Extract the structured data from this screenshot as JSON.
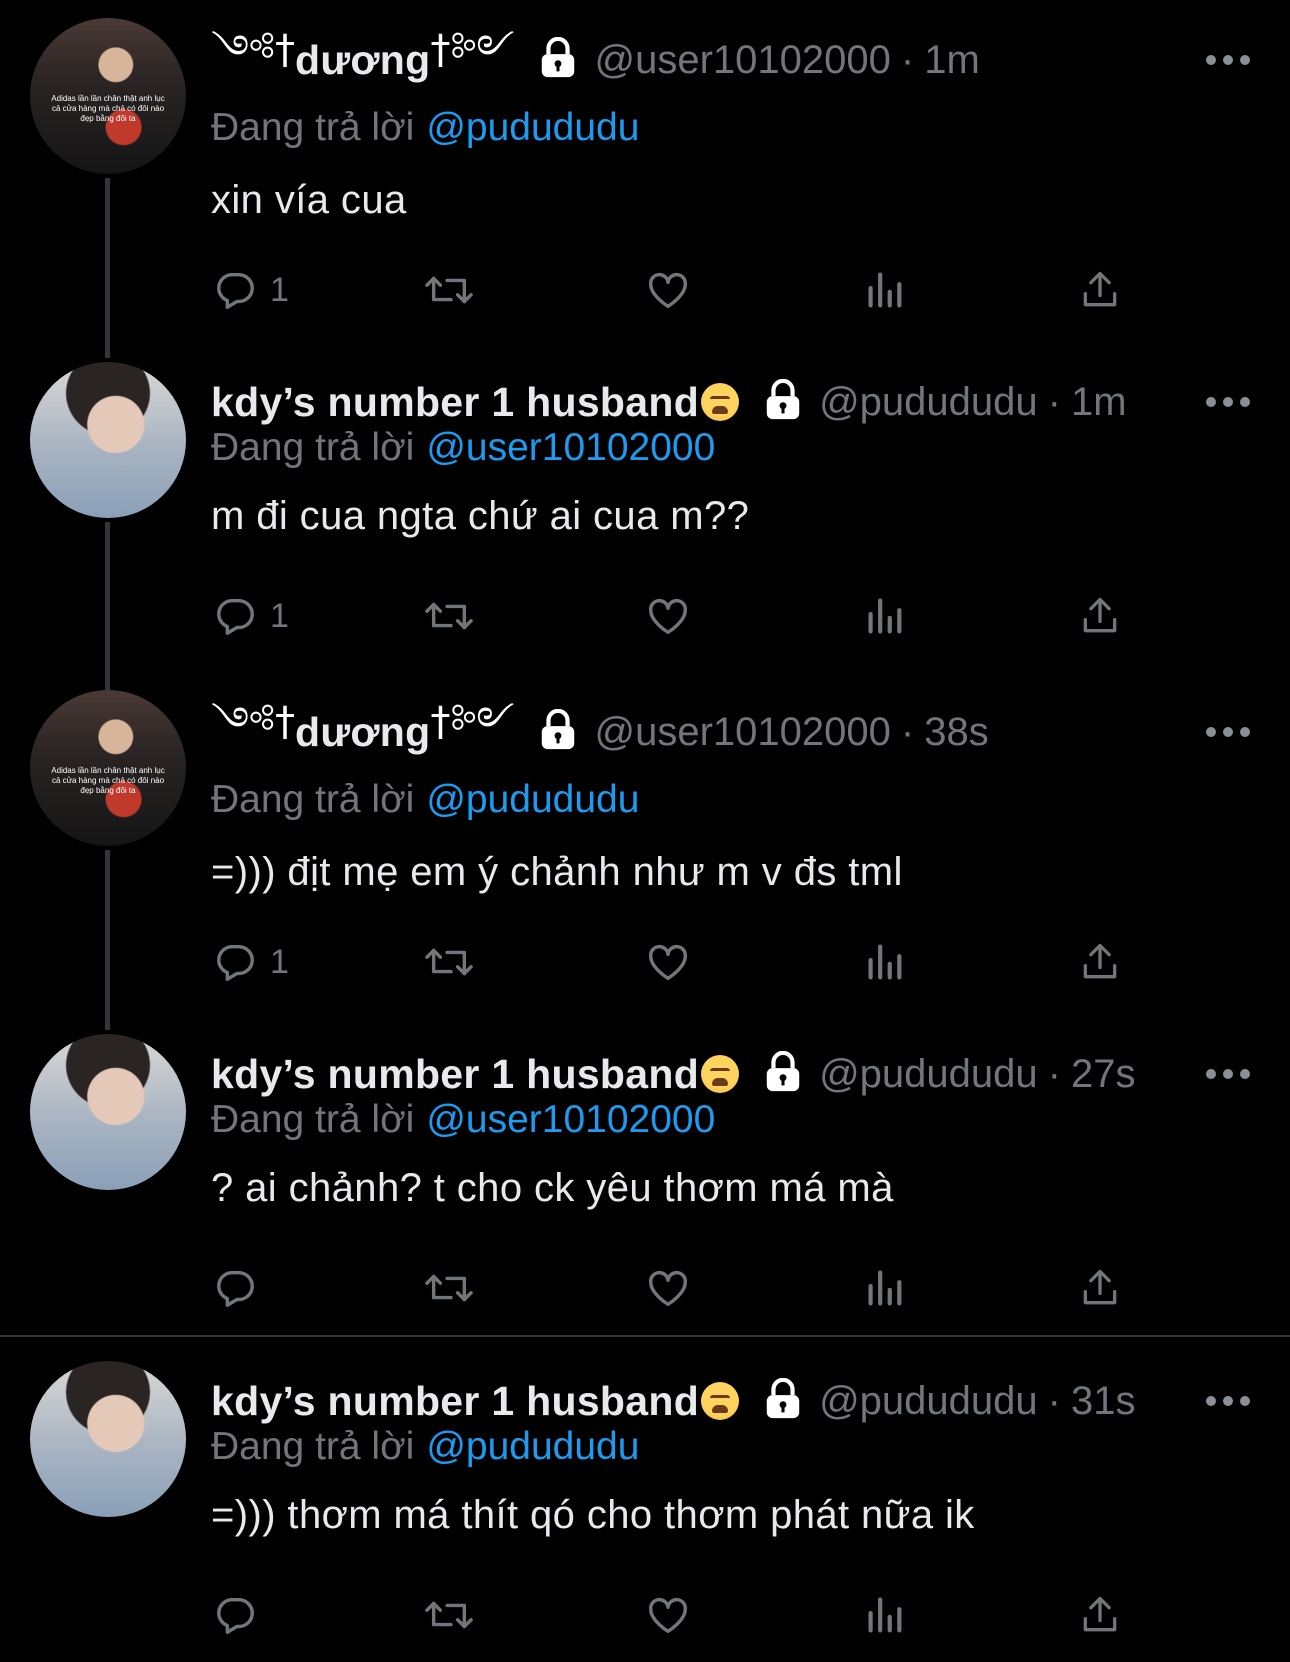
{
  "tweets": [
    {
      "display_name": "dương",
      "deco_left": "༺†",
      "deco_right": "†༻",
      "emoji": "",
      "handle": "@user10102000",
      "time": "1m",
      "replying_label": "Đang trả lời",
      "replying_to": "@pudududu",
      "text": "xin vía cua",
      "reply_count": "1",
      "avatar_caption": "Adidas lần lần chân thật anh lục cả cửa hàng mà chả có đôi nào đẹp bằng đôi ta",
      "avatar_style": "a1"
    },
    {
      "display_name": "kdy’s number 1 husband",
      "deco_left": "",
      "deco_right": "",
      "emoji": "tired-face-emoji",
      "handle": "@pudududu",
      "time": "1m",
      "replying_label": "Đang trả lời",
      "replying_to": "@user10102000",
      "text": "m đi cua ngta chứ ai cua m??",
      "reply_count": "1",
      "avatar_caption": "",
      "avatar_style": "a2"
    },
    {
      "display_name": "dương",
      "deco_left": "༺†",
      "deco_right": "†༻",
      "emoji": "",
      "handle": "@user10102000",
      "time": "38s",
      "replying_label": "Đang trả lời",
      "replying_to": "@pudududu",
      "text": "=))) địt mẹ em ý chảnh như m v đs tml",
      "reply_count": "1",
      "avatar_caption": "Adidas lần lần chân thật anh lục cả cửa hàng mà chả có đôi nào đẹp bằng đôi ta",
      "avatar_style": "a1"
    },
    {
      "display_name": "kdy’s number 1 husband",
      "deco_left": "",
      "deco_right": "",
      "emoji": "tired-face-emoji",
      "handle": "@pudududu",
      "time": "27s",
      "replying_label": "Đang trả lời",
      "replying_to": "@user10102000",
      "text": "? ai chảnh? t cho ck yêu thơm má mà",
      "reply_count": "",
      "avatar_caption": "",
      "avatar_style": "a2"
    },
    {
      "display_name": "kdy’s number 1 husband",
      "deco_left": "",
      "deco_right": "",
      "emoji": "tired-face-emoji",
      "handle": "@pudududu",
      "time": "31s",
      "replying_label": "Đang trả lời",
      "replying_to": "@pudududu",
      "text": "=))) thơm má thít qó cho thơm phát nữa ik",
      "reply_count": "",
      "avatar_caption": "",
      "avatar_style": "a2"
    }
  ],
  "header_separator": "·",
  "colors": {
    "background": "#000000",
    "text": "#e7e9ea",
    "muted": "#71767b",
    "link": "#1d9bf0",
    "thread_line": "#333639"
  },
  "icons": [
    "reply-icon",
    "retweet-icon",
    "like-icon",
    "views-icon",
    "share-icon",
    "lock-icon",
    "more-icon"
  ]
}
